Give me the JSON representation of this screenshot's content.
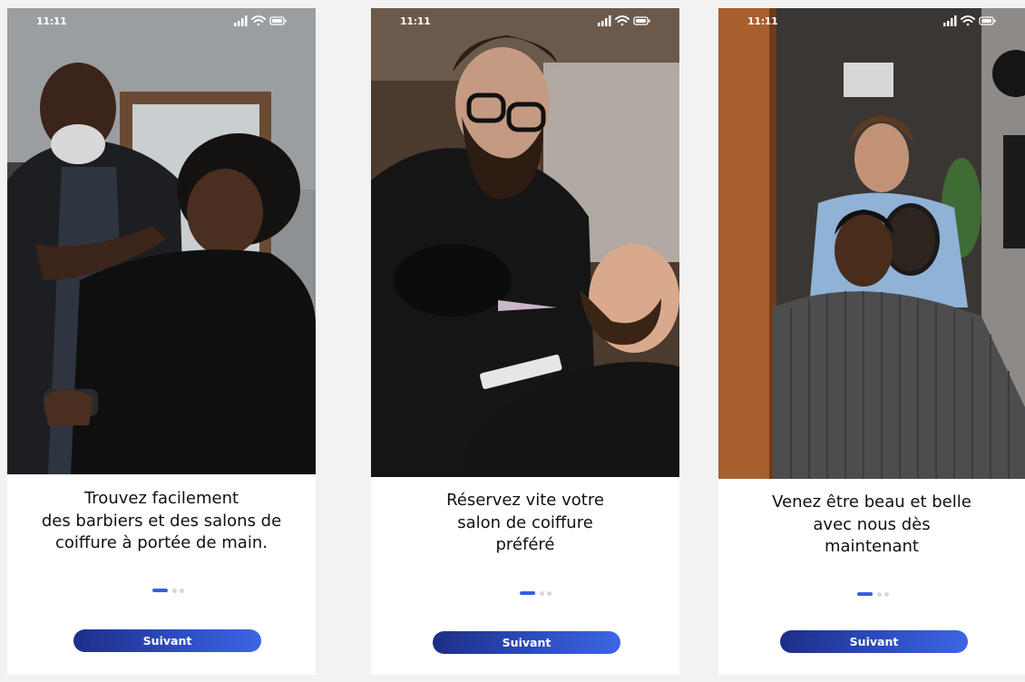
{
  "screens": [
    {
      "status_time": "11:11",
      "headline": "Trouvez facilement\ndes barbiers et des salons de\ncoiffure à portée de main.",
      "pagination": {
        "active": 1,
        "total": 3
      },
      "next_label": "Suivant"
    },
    {
      "status_time": "11:11",
      "headline": "Réservez vite votre\nsalon de coiffure\npréféré",
      "pagination": {
        "active": 1,
        "total": 3
      },
      "next_label": "Suivant"
    },
    {
      "status_time": "11:11",
      "headline": "Venez être beau et belle\navec nous dès\nmaintenant",
      "pagination": {
        "active": 1,
        "total": 3
      },
      "next_label": "Suivant"
    }
  ],
  "icons": [
    "signal-icon",
    "wifi-icon",
    "battery-icon"
  ],
  "colors": {
    "accent": "#3561e0",
    "button_gradient_start": "#1d2f86",
    "button_gradient_end": "#3d66e4",
    "inactive_dot": "#d5d7dd",
    "background": "#f2f2f3"
  }
}
